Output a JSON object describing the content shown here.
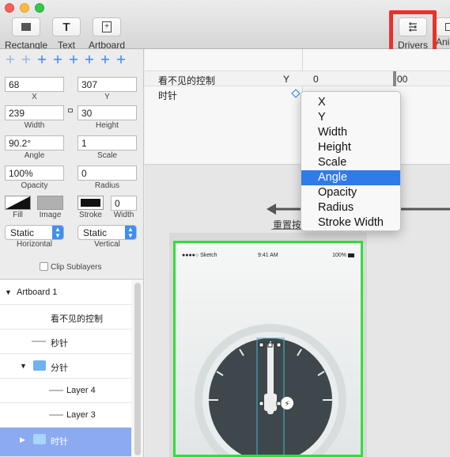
{
  "toolbar": {
    "rectangle": "Rectangle",
    "text": "Text",
    "artboard": "Artboard",
    "drivers": "Drivers",
    "animation_partial": "Anim"
  },
  "inspector": {
    "x": {
      "value": "68",
      "label": "X"
    },
    "y": {
      "value": "307",
      "label": "Y"
    },
    "width": {
      "value": "239",
      "label": "Width"
    },
    "height": {
      "value": "30",
      "label": "Height"
    },
    "angle": {
      "value": "90.2°",
      "label": "Angle"
    },
    "scale": {
      "value": "1",
      "label": "Scale"
    },
    "opacity": {
      "value": "100%",
      "label": "Opacity"
    },
    "radius": {
      "value": "0",
      "label": "Radius"
    },
    "fill_label": "Fill",
    "image_label": "Image",
    "stroke_label": "Stroke",
    "stroke_width": {
      "value": "0",
      "label": "Width"
    },
    "horizontal": {
      "value": "Static",
      "label": "Horizontal"
    },
    "vertical": {
      "value": "Static",
      "label": "Vertical"
    },
    "clip_sublayers": "Clip Sublayers"
  },
  "layers": [
    {
      "name": "Artboard 1"
    },
    {
      "name": "看不见的控制"
    },
    {
      "name": "秒针"
    },
    {
      "name": "分针"
    },
    {
      "name": "Layer 4"
    },
    {
      "name": "Layer 3"
    },
    {
      "name": "时针"
    }
  ],
  "timeline": {
    "row1_name": "看不见的控制",
    "row1_prop": "Y",
    "row2_name": "时针",
    "tick_0": "0",
    "tick_100": "00"
  },
  "canvas": {
    "hint_text": "重置按",
    "status_carrier": "●●●●○ Sketch",
    "status_time": "9:41 AM",
    "status_battery": "100%"
  },
  "dropdown": {
    "items": [
      "X",
      "Y",
      "Width",
      "Height",
      "Scale",
      "Angle",
      "Opacity",
      "Radius",
      "Stroke Width"
    ],
    "selected": "Angle"
  },
  "colors": {
    "highlight_red": "#e8322c",
    "menu_selected": "#2f7be8",
    "artboard_border": "#2ee03a",
    "layer_selected": "#8caaf0"
  }
}
